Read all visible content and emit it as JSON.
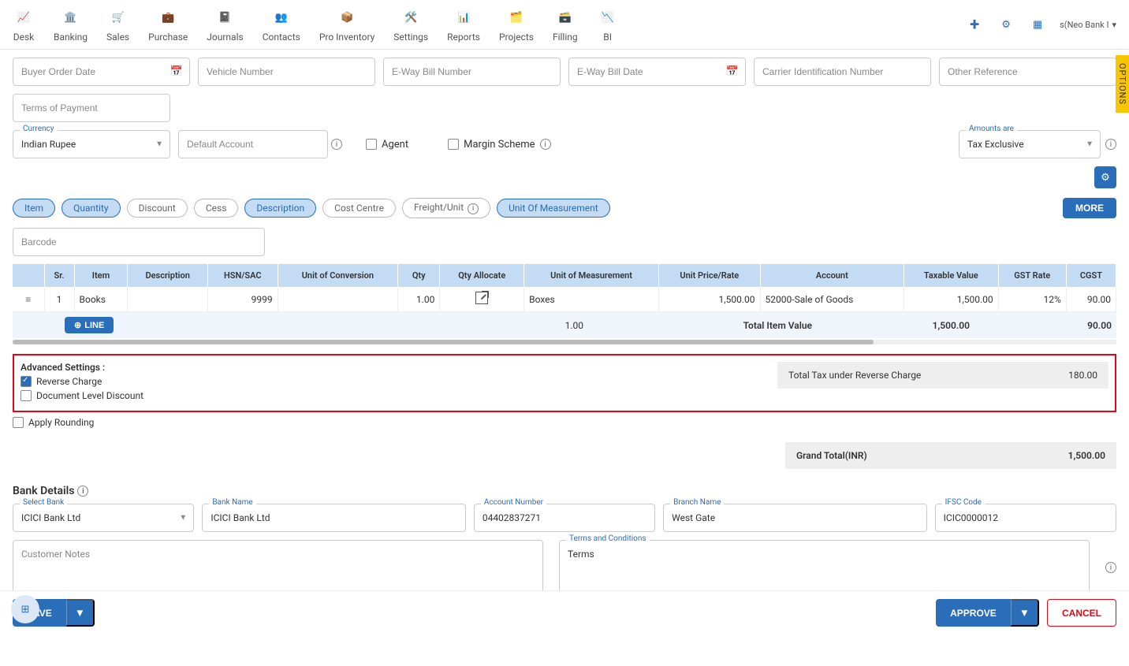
{
  "nav": [
    {
      "label": "Desk"
    },
    {
      "label": "Banking"
    },
    {
      "label": "Sales"
    },
    {
      "label": "Purchase"
    },
    {
      "label": "Journals"
    },
    {
      "label": "Contacts"
    },
    {
      "label": "Pro Inventory"
    },
    {
      "label": "Settings"
    },
    {
      "label": "Reports"
    },
    {
      "label": "Projects"
    },
    {
      "label": "Filling"
    },
    {
      "label": "BI"
    }
  ],
  "user": {
    "name": "s(Neo Bank I"
  },
  "options_tab": "OPTIONS",
  "row1": {
    "buyer_order_date": "Buyer Order Date",
    "vehicle_number": "Vehicle Number",
    "eway_bill_number": "E-Way Bill Number",
    "eway_bill_date": "E-Way Bill Date",
    "carrier_id": "Carrier Identification Number",
    "other_ref": "Other Reference"
  },
  "row2": {
    "terms_of_payment": "Terms of Payment"
  },
  "row3": {
    "currency": {
      "label": "Currency",
      "value": "Indian Rupee"
    },
    "default_account": "Default Account",
    "agent": "Agent",
    "margin_scheme": "Margin Scheme",
    "amounts": {
      "label": "Amounts are",
      "value": "Tax Exclusive"
    }
  },
  "chips": {
    "item": "Item",
    "quantity": "Quantity",
    "discount": "Discount",
    "cess": "Cess",
    "description": "Description",
    "cost_centre": "Cost Centre",
    "freight": "Freight/Unit",
    "uom": "Unit Of Measurement",
    "more": "MORE"
  },
  "barcode_ph": "Barcode",
  "table": {
    "headers": [
      "",
      "Sr.",
      "Item",
      "Description",
      "HSN/SAC",
      "Unit of Conversion",
      "Qty",
      "Qty Allocate",
      "Unit of Measurement",
      "Unit Price/Rate",
      "Account",
      "Taxable Value",
      "GST Rate",
      "CGST"
    ],
    "row": {
      "sr": "1",
      "item": "Books",
      "desc": "",
      "hsn": "9999",
      "uoc": "",
      "qty": "1.00",
      "qty_alloc": "",
      "uom": "Boxes",
      "rate": "1,500.00",
      "account": "52000-Sale of Goods",
      "taxable": "1,500.00",
      "gst": "12%",
      "cgst": "90.00"
    },
    "footer": {
      "line": "LINE",
      "qty": "1.00",
      "total_label": "Total Item Value",
      "taxable": "1,500.00",
      "cgst": "90.00"
    }
  },
  "advanced": {
    "title": "Advanced Settings :",
    "reverse_charge": "Reverse Charge",
    "doc_discount": "Document Level Discount",
    "apply_rounding": "Apply Rounding",
    "rc_total_label": "Total Tax under Reverse Charge",
    "rc_total": "180.00"
  },
  "grand_total": {
    "label": "Grand Total(INR)",
    "value": "1,500.00"
  },
  "bank": {
    "title": "Bank Details",
    "select_bank": {
      "label": "Select Bank",
      "value": "ICICI Bank Ltd"
    },
    "bank_name": {
      "label": "Bank Name",
      "value": "ICICI Bank Ltd"
    },
    "acct": {
      "label": "Account Number",
      "value": "04402837271"
    },
    "branch": {
      "label": "Branch Name",
      "value": "West Gate"
    },
    "ifsc": {
      "label": "IFSC Code",
      "value": "ICIC0000012"
    }
  },
  "notes": {
    "customer_notes": "Customer Notes",
    "tnc_label": "Terms and Conditions",
    "tnc_value": "Terms"
  },
  "footer": {
    "save": "SAVE",
    "approve": "APPROVE",
    "cancel": "CANCEL"
  }
}
